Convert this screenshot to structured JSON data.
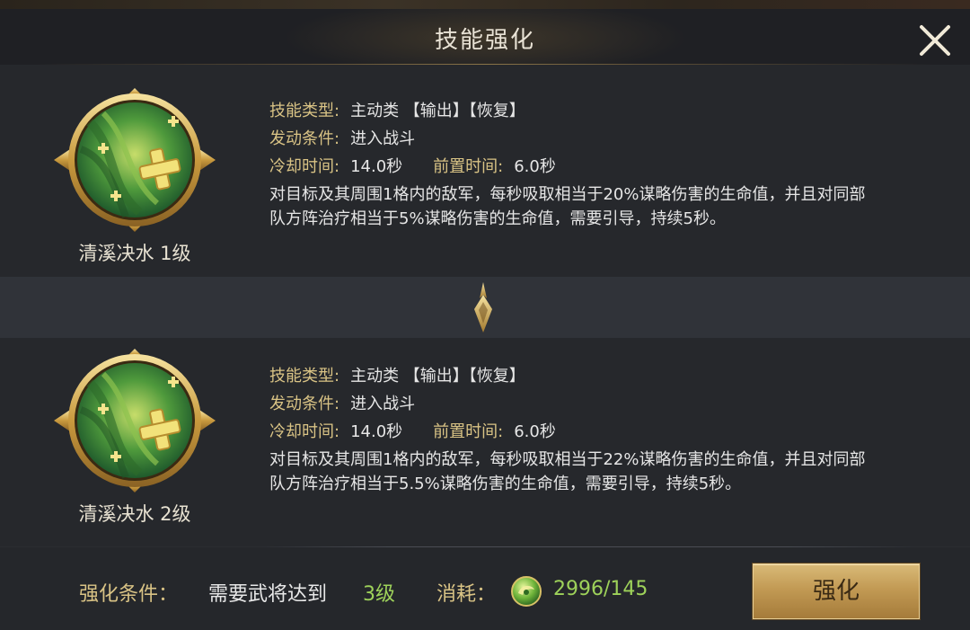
{
  "dialog": {
    "title": "技能强化"
  },
  "skills": [
    {
      "name": "清溪决水",
      "level": "1级",
      "type_label": "技能类型:",
      "type_value": "主动类 【输出】【恢复】",
      "trigger_label": "发动条件:",
      "trigger_value": "进入战斗",
      "cooldown_label": "冷却时间:",
      "cooldown_value": "14.0秒",
      "prep_label": "前置时间:",
      "prep_value": "6.0秒",
      "description": "对目标及其周围1格内的敌军，每秒吸取相当于20%谋略伤害的生命值，并且对同部队方阵治疗相当于5%谋略伤害的生命值，需要引导，持续5秒。"
    },
    {
      "name": "清溪决水",
      "level": "2级",
      "type_label": "技能类型:",
      "type_value": "主动类 【输出】【恢复】",
      "trigger_label": "发动条件:",
      "trigger_value": "进入战斗",
      "cooldown_label": "冷却时间:",
      "cooldown_value": "14.0秒",
      "prep_label": "前置时间:",
      "prep_value": "6.0秒",
      "description": "对目标及其周围1格内的敌军，每秒吸取相当于22%谋略伤害的生命值，并且对同部队方阵治疗相当于5.5%谋略伤害的生命值，需要引导，持续5秒。"
    }
  ],
  "footer": {
    "condition_label": "强化条件：",
    "condition_text": "需要武将达到",
    "condition_level": "3级",
    "cost_label": "消耗：",
    "cost_value": "2996/145",
    "upgrade_button": "强化"
  },
  "colors": {
    "gold_label": "#d9c385",
    "green_value": "#9ed25a",
    "button_gold": "#c29a54"
  },
  "icons": {
    "close": "close-icon",
    "skill": "skill-leaf-cross-icon",
    "arrow": "arrow-down-icon",
    "currency": "jade-coin-icon"
  }
}
